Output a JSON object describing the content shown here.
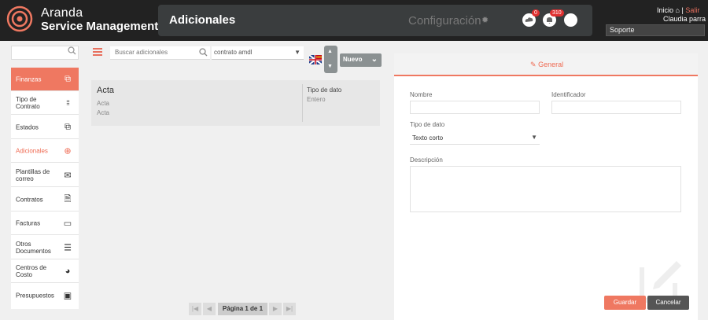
{
  "header": {
    "brand_line1": "Aranda",
    "brand_line2": "Service Management",
    "page_title": "Adicionales",
    "config_label": "Configuración",
    "cloud_badge": "0",
    "bell_badge": "310",
    "inicio_label": "Inicio",
    "separator": "|",
    "salir_label": "Salir",
    "user_name": "Claudia parra",
    "support_value": "Soporte"
  },
  "sidebar": {
    "items": [
      {
        "label": "Finanzas",
        "icon": "copy-icon",
        "glyph": "⧉"
      },
      {
        "label": "Tipo de Contrato",
        "icon": "grid-icon",
        "glyph": "⁞⁞⁞"
      },
      {
        "label": "Estados",
        "icon": "copy-icon",
        "glyph": "⧉"
      },
      {
        "label": "Adicionales",
        "icon": "plus-circle-icon",
        "glyph": "⊕"
      },
      {
        "label": "Plantillas de correo",
        "icon": "mail-icon",
        "glyph": "✉"
      },
      {
        "label": "Contratos",
        "icon": "document-icon",
        "glyph": "🗎"
      },
      {
        "label": "Facturas",
        "icon": "card-icon",
        "glyph": "▭"
      },
      {
        "label": "Otros Documentos",
        "icon": "list-document-icon",
        "glyph": "☰"
      },
      {
        "label": "Centros de Costo",
        "icon": "pie-chart-icon",
        "glyph": "◕"
      },
      {
        "label": "Presupuestos",
        "icon": "money-icon",
        "glyph": "▣"
      }
    ]
  },
  "toolbar": {
    "search_placeholder": "Buscar adicionales",
    "select_value": "contrato amdl",
    "nuevo_label": "Nuevo"
  },
  "list": {
    "card": {
      "title": "Acta",
      "line1": "Acta",
      "line2": "Acta",
      "type_header": "Tipo de dato",
      "type_value": "Entero"
    }
  },
  "pager": {
    "first": "|◀",
    "prev": "◀",
    "info": "Página 1 de 1",
    "next": "▶",
    "last": "▶|"
  },
  "form": {
    "tab_general": "General",
    "nombre_label": "Nombre",
    "identificador_label": "Identificador",
    "tipo_label": "Tipo de dato",
    "tipo_value": "Texto corto",
    "descripcion_label": "Descripción",
    "guardar_label": "Guardar",
    "cancelar_label": "Cancelar"
  },
  "colors": {
    "accent": "#ef7861",
    "topbar": "#222222"
  }
}
